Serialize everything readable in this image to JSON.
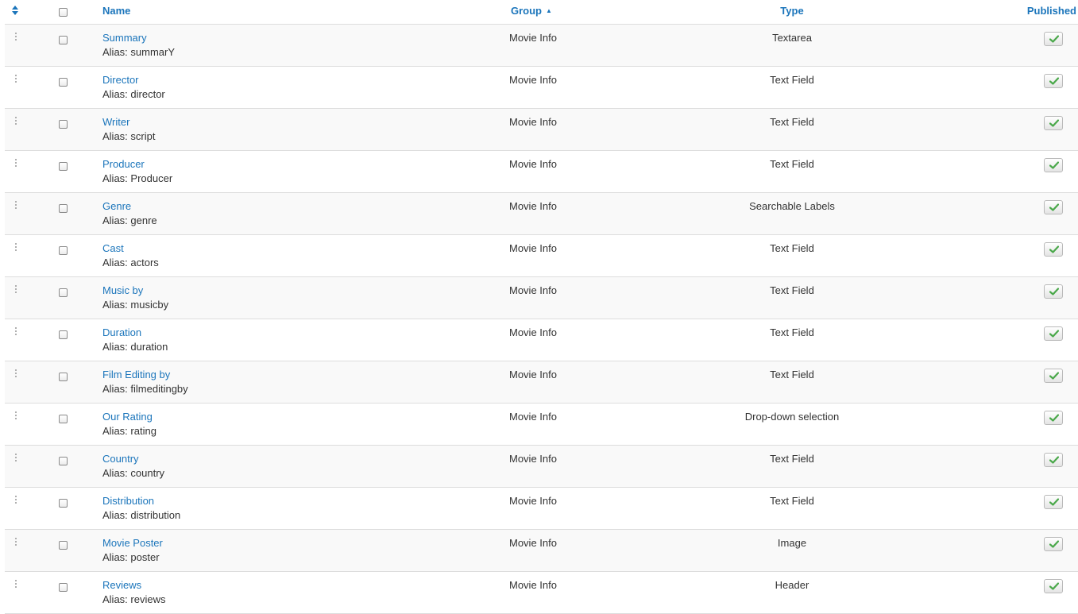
{
  "header": {
    "name": "Name",
    "group": "Group",
    "type": "Type",
    "published": "Published"
  },
  "rows": [
    {
      "name": "Summary",
      "alias": "Alias: summarY",
      "group": "Movie Info",
      "type": "Textarea"
    },
    {
      "name": "Director",
      "alias": "Alias: director",
      "group": "Movie Info",
      "type": "Text Field"
    },
    {
      "name": "Writer",
      "alias": "Alias: script",
      "group": "Movie Info",
      "type": "Text Field"
    },
    {
      "name": "Producer",
      "alias": "Alias: Producer",
      "group": "Movie Info",
      "type": "Text Field"
    },
    {
      "name": "Genre",
      "alias": "Alias: genre",
      "group": "Movie Info",
      "type": "Searchable Labels"
    },
    {
      "name": "Cast",
      "alias": "Alias: actors",
      "group": "Movie Info",
      "type": "Text Field"
    },
    {
      "name": "Music by",
      "alias": "Alias: musicby",
      "group": "Movie Info",
      "type": "Text Field"
    },
    {
      "name": "Duration",
      "alias": "Alias: duration",
      "group": "Movie Info",
      "type": "Text Field"
    },
    {
      "name": "Film Editing by",
      "alias": "Alias: filmeditingby",
      "group": "Movie Info",
      "type": "Text Field"
    },
    {
      "name": "Our Rating",
      "alias": "Alias: rating",
      "group": "Movie Info",
      "type": "Drop-down selection"
    },
    {
      "name": "Country",
      "alias": "Alias: country",
      "group": "Movie Info",
      "type": "Text Field"
    },
    {
      "name": "Distribution",
      "alias": "Alias: distribution",
      "group": "Movie Info",
      "type": "Text Field"
    },
    {
      "name": "Movie Poster",
      "alias": "Alias: poster",
      "group": "Movie Info",
      "type": "Image"
    },
    {
      "name": "Reviews",
      "alias": "Alias: reviews",
      "group": "Movie Info",
      "type": "Header"
    }
  ],
  "icons": {
    "ordering": "sort-updown-icon",
    "drag": "drag-handle-icon",
    "published": "check-icon"
  },
  "colors": {
    "link": "#1b75bb",
    "check": "#4aa84a",
    "row_alt": "#f9f9f9",
    "border": "#dddddd"
  }
}
